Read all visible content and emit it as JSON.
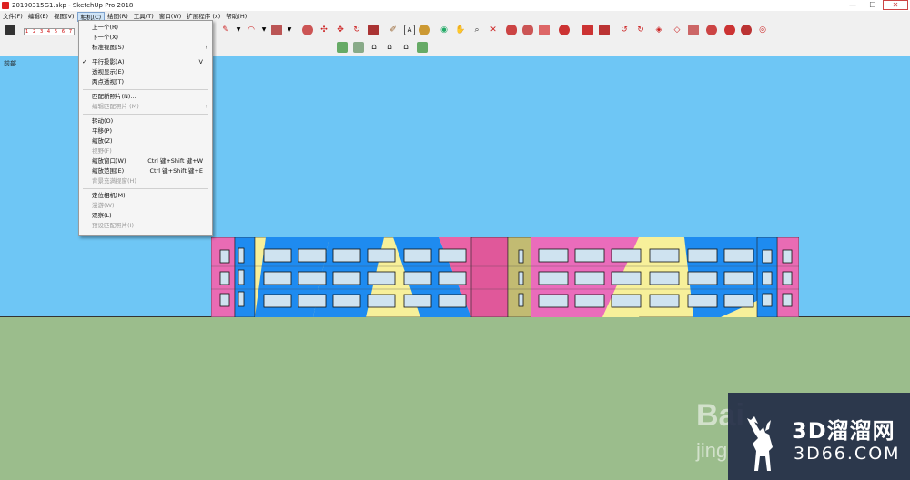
{
  "window": {
    "title": "20190315G1.skp - SketchUp Pro 2018",
    "minimize_glyph": "—",
    "maximize_glyph": "☐",
    "close_glyph": "✕"
  },
  "menubar": {
    "items": [
      {
        "label": "文件(F)"
      },
      {
        "label": "编辑(E)"
      },
      {
        "label": "视图(V)"
      },
      {
        "label": "相机(C)"
      },
      {
        "label": "绘图(R)"
      },
      {
        "label": "工具(T)"
      },
      {
        "label": "窗口(W)"
      },
      {
        "label": "扩展程序 (x)"
      },
      {
        "label": "帮助(H)"
      }
    ],
    "active_index": 3
  },
  "toolbar": {
    "scale_digits": "1 2 3 4 5 6 7 8 9",
    "icons": [
      "eraser-icon",
      "pencil-icon",
      "arc-icon",
      "shape-icon",
      "push-pull-icon",
      "move-icon",
      "rotate-icon",
      "scale-icon",
      "offset-icon",
      "tape-icon",
      "text-icon",
      "paint-icon",
      "orbit-icon",
      "pan-icon",
      "zoom-icon",
      "zoom-extents-icon",
      "warehouse-icon",
      "sandbox-icon",
      "solid-icon",
      "section-icon",
      "style-icon",
      "shadow-icon"
    ]
  },
  "viewport": {
    "scene_label": "前部",
    "sky_color": "#6ec6f5",
    "ground_color": "#9bbd8c"
  },
  "camera_menu": {
    "items": [
      {
        "label": "上一个(R)",
        "shortcut": "",
        "enabled": true,
        "checked": false,
        "submenu": false
      },
      {
        "label": "下一个(X)",
        "shortcut": "",
        "enabled": true,
        "checked": false,
        "submenu": false
      },
      {
        "label": "标准视图(S)",
        "shortcut": "",
        "enabled": true,
        "checked": false,
        "submenu": true
      },
      {
        "label": "平行投影(A)",
        "shortcut": "V",
        "enabled": true,
        "checked": true,
        "submenu": false
      },
      {
        "label": "透视显示(E)",
        "shortcut": "",
        "enabled": true,
        "checked": false,
        "submenu": false
      },
      {
        "label": "两点透视(T)",
        "shortcut": "",
        "enabled": true,
        "checked": false,
        "submenu": false
      },
      {
        "label": "匹配新照片(N)...",
        "shortcut": "",
        "enabled": true,
        "checked": false,
        "submenu": false
      },
      {
        "label": "编辑匹配照片 (M)",
        "shortcut": "",
        "enabled": false,
        "checked": false,
        "submenu": true
      },
      {
        "label": "转动(O)",
        "shortcut": "",
        "enabled": true,
        "checked": false,
        "submenu": false
      },
      {
        "label": "平移(P)",
        "shortcut": "",
        "enabled": true,
        "checked": false,
        "submenu": false
      },
      {
        "label": "缩放(Z)",
        "shortcut": "",
        "enabled": true,
        "checked": false,
        "submenu": false
      },
      {
        "label": "视野(F)",
        "shortcut": "",
        "enabled": false,
        "checked": false,
        "submenu": false
      },
      {
        "label": "缩放窗口(W)",
        "shortcut": "Ctrl 键+Shift 键+W",
        "enabled": true,
        "checked": false,
        "submenu": false
      },
      {
        "label": "缩放范围(E)",
        "shortcut": "Ctrl 键+Shift 键+E",
        "enabled": true,
        "checked": false,
        "submenu": false
      },
      {
        "label": "背景充满视窗(H)",
        "shortcut": "",
        "enabled": false,
        "checked": false,
        "submenu": false
      },
      {
        "label": "定位相机(M)",
        "shortcut": "",
        "enabled": true,
        "checked": false,
        "submenu": false
      },
      {
        "label": "漫游(W)",
        "shortcut": "",
        "enabled": false,
        "checked": false,
        "submenu": false
      },
      {
        "label": "观察(L)",
        "shortcut": "",
        "enabled": true,
        "checked": false,
        "submenu": false
      },
      {
        "label": "预设匹配照片(I)",
        "shortcut": "",
        "enabled": false,
        "checked": false,
        "submenu": false
      }
    ],
    "check_glyph": "✓",
    "submenu_glyph": "›"
  },
  "watermark": {
    "brand_cn": "3D溜溜网",
    "brand_en": "3D66.COM",
    "baidu_text": "Bai",
    "jingyan_text": "jing"
  }
}
